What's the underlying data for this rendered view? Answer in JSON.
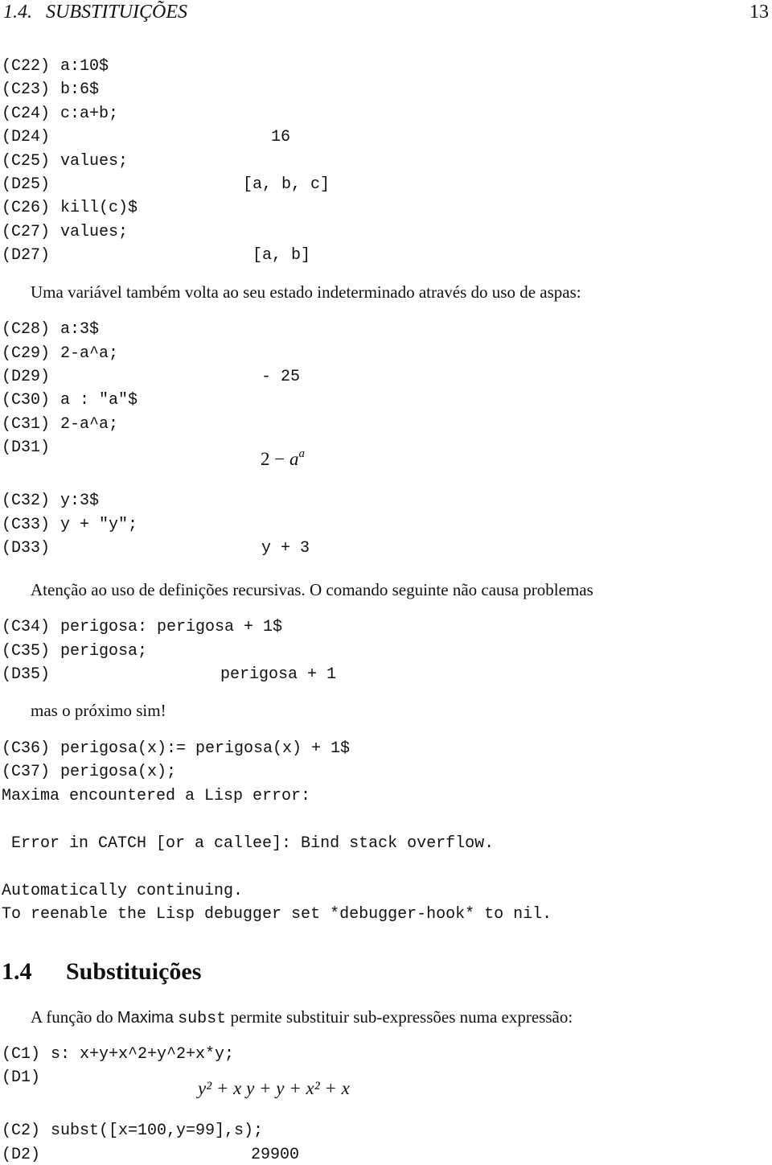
{
  "header": {
    "section_label": "1.4.",
    "section_title": "SUBSTITUIÇÕES",
    "page_number": "13"
  },
  "block1": [
    {
      "label": "(C22)",
      "text": "a:10$"
    },
    {
      "label": "(C23)",
      "text": "b:6$"
    },
    {
      "label": "(C24)",
      "text": "c:a+b;"
    },
    {
      "label": "(D24)",
      "text": "16"
    },
    {
      "label": "(C25)",
      "text": "values;"
    },
    {
      "label": "(D25)",
      "text": "[a, b, c]"
    },
    {
      "label": "(C26)",
      "text": "kill(c)$"
    },
    {
      "label": "(C27)",
      "text": "values;"
    },
    {
      "label": "(D27)",
      "text": "[a, b]"
    }
  ],
  "para1": "Uma variável também volta ao seu estado indeterminado através do uso de aspas:",
  "block2": [
    {
      "label": "(C28)",
      "text": "a:3$"
    },
    {
      "label": "(C29)",
      "text": "2-a^a;"
    },
    {
      "label": "(D29)",
      "text": "- 25"
    },
    {
      "label": "(C30)",
      "text": "a : \"a\"$"
    },
    {
      "label": "(C31)",
      "text": "2-a^a;"
    },
    {
      "label": "(D31)",
      "math": {
        "base": "2 − ",
        "var": "a",
        "exp": "a"
      }
    },
    {
      "label": "(C32)",
      "text": "y:3$"
    },
    {
      "label": "(C33)",
      "text": "y + \"y\";"
    },
    {
      "label": "(D33)",
      "text": "y + 3"
    }
  ],
  "para2": "Atenção ao uso de definições recursivas. O comando seguinte não causa problemas",
  "block3": [
    {
      "label": "(C34)",
      "text": "perigosa: perigosa + 1$"
    },
    {
      "label": "(C35)",
      "text": "perigosa;"
    },
    {
      "label": "(D35)",
      "text": "perigosa + 1"
    }
  ],
  "para3": "mas o próximo sim!",
  "block4": [
    {
      "label": "(C36)",
      "text": "perigosa(x):= perigosa(x) + 1$"
    },
    {
      "label": "(C37)",
      "text": "perigosa(x);"
    }
  ],
  "error": {
    "line1": "Maxima encountered a Lisp error:",
    "line2": " Error in CATCH [or a callee]: Bind stack overflow.",
    "line3": "Automatically continuing.",
    "line4": "To reenable the Lisp debugger set *debugger-hook* to nil."
  },
  "section": {
    "number": "1.4",
    "title": "Substituições"
  },
  "para4": {
    "before": "A função do ",
    "maxima": "Maxima",
    "code": "subst",
    "after": " permite substituir sub-expressões numa expressão:"
  },
  "block5": [
    {
      "label": "(C1)",
      "text": "s: x+y+x^2+y^2+x*y;"
    },
    {
      "label": "(D1)",
      "math": "y² + x y + y + x² + x"
    },
    {
      "label": "(C2)",
      "text": "subst([x=100,y=99],s);"
    },
    {
      "label": "(D2)",
      "text": "29900"
    }
  ]
}
